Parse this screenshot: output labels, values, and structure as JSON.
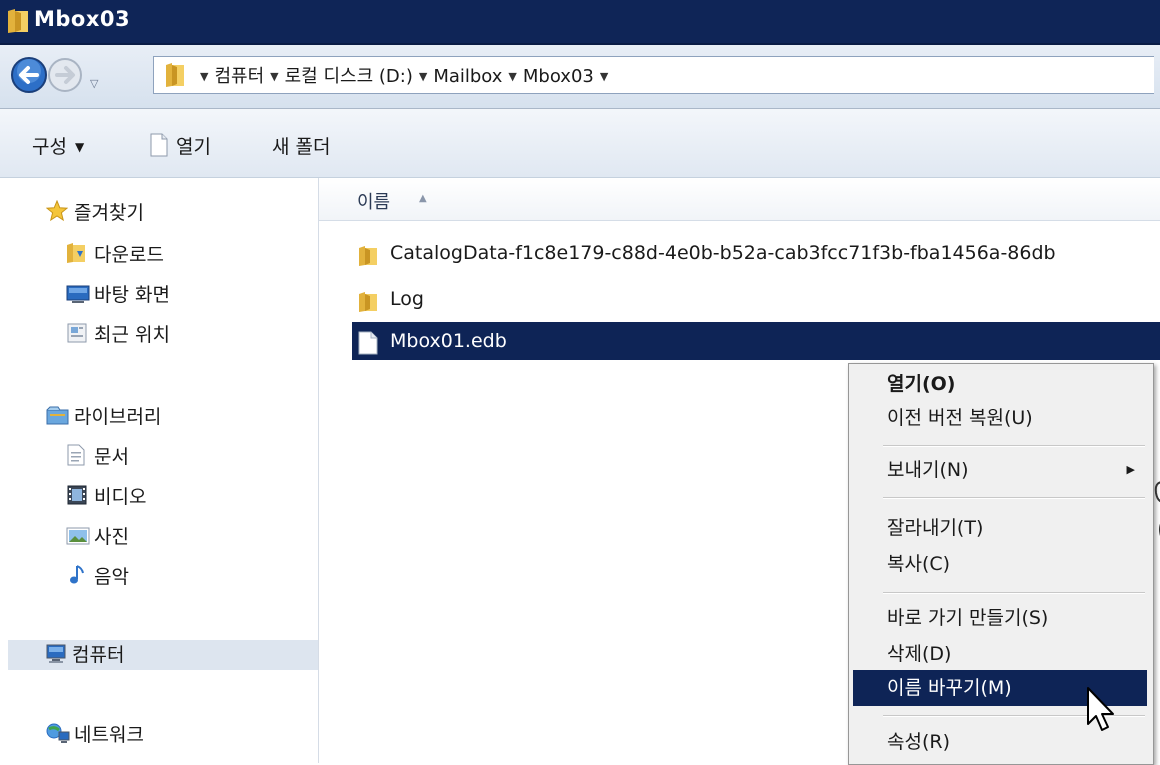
{
  "window": {
    "title": "Mbox03"
  },
  "address": {
    "crumbs": [
      "컴퓨터",
      "로컬 디스크 (D:)",
      "Mailbox",
      "Mbox03"
    ]
  },
  "toolbar": {
    "organize": "구성",
    "open": "열기",
    "new_folder": "새 폴더"
  },
  "nav": {
    "favorites": "즐겨찾기",
    "downloads": "다운로드",
    "desktop": "바탕 화면",
    "recent": "최근 위치",
    "libraries": "라이브러리",
    "documents": "문서",
    "videos": "비디오",
    "pictures": "사진",
    "music": "음악",
    "computer": "컴퓨터",
    "network": "네트워크"
  },
  "columns": {
    "name": "이름"
  },
  "files": [
    {
      "name": "CatalogData-f1c8e179-c88d-4e0b-b52a-cab3fcc71f3b-fba1456a-86db",
      "type": "folder"
    },
    {
      "name": "Log",
      "type": "folder"
    },
    {
      "name": "Mbox01.edb",
      "type": "file"
    }
  ],
  "context_menu": {
    "open": "열기(O)",
    "restore": "이전 버전 복원(U)",
    "send_to": "보내기(N)",
    "cut": "잘라내기(T)",
    "copy": "복사(C)",
    "shortcut": "바로 가기 만들기(S)",
    "delete": "삭제(D)",
    "rename": "이름 바꾸기(M)",
    "properties": "속성(R)"
  },
  "colors": {
    "titlebar": "#0f2557",
    "selection": "#0e2456",
    "menu_bg": "#f0f0f0"
  }
}
